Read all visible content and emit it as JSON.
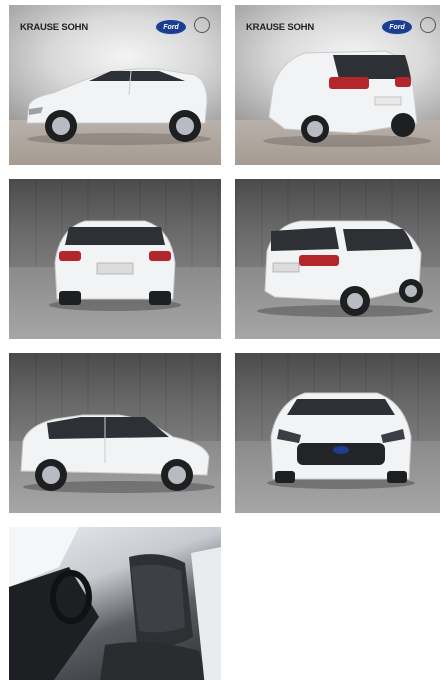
{
  "gallery": {
    "watermark": {
      "dealer_name": "KRAUSE SOHN",
      "brand_badge": "Ford"
    },
    "photos": [
      {
        "view": "front-left-side",
        "background": "showroom",
        "watermarked": true
      },
      {
        "view": "rear-right",
        "background": "showroom",
        "watermarked": true
      },
      {
        "view": "rear",
        "background": "studio"
      },
      {
        "view": "rear-right-three-quarter",
        "background": "studio"
      },
      {
        "view": "left-side",
        "background": "studio"
      },
      {
        "view": "front",
        "background": "studio"
      },
      {
        "view": "interior-driver-seat",
        "background": "interior"
      }
    ]
  },
  "colors": {
    "car_body": "#f2f3f4",
    "studio_wall": "#5c5c5c",
    "studio_floor": "#9a9a9a",
    "ford_blue": "#1d3d8f",
    "dealer_accent": "#e06a1b"
  }
}
